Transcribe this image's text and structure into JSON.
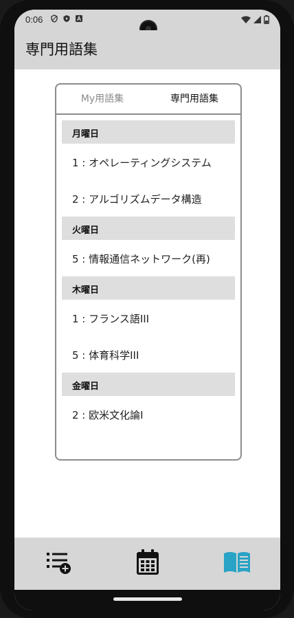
{
  "status_bar": {
    "time": "0:06",
    "icons": [
      "shield-icon",
      "play-protect-icon",
      "app-notification-icon",
      "wifi-icon",
      "signal-icon",
      "battery-icon"
    ]
  },
  "app_bar": {
    "title": "専門用語集"
  },
  "tabs": [
    {
      "label": "My用語集",
      "selected": false
    },
    {
      "label": "専門用語集",
      "selected": true
    }
  ],
  "days": [
    {
      "label": "月曜日",
      "courses": [
        "1 : オペレーティングシステム",
        "2 : アルゴリズムデータ構造"
      ]
    },
    {
      "label": "火曜日",
      "courses": [
        "5 : 情報通信ネットワーク(再)"
      ]
    },
    {
      "label": "木曜日",
      "courses": [
        "1 : フランス語III",
        "5 : 体育科学III"
      ]
    },
    {
      "label": "金曜日",
      "courses": [
        "2 : 欧米文化論I"
      ]
    }
  ],
  "bottom_nav": {
    "items": [
      {
        "icon": "playlist-add-icon",
        "active": false
      },
      {
        "icon": "calendar-icon",
        "active": false
      },
      {
        "icon": "book-icon",
        "active": true
      }
    ],
    "active_color": "#29a3c6",
    "inactive_color": "#111111"
  },
  "colors": {
    "bars": "#d6d6d6",
    "day_header": "#dedede",
    "card_border": "#8c8c8c"
  }
}
